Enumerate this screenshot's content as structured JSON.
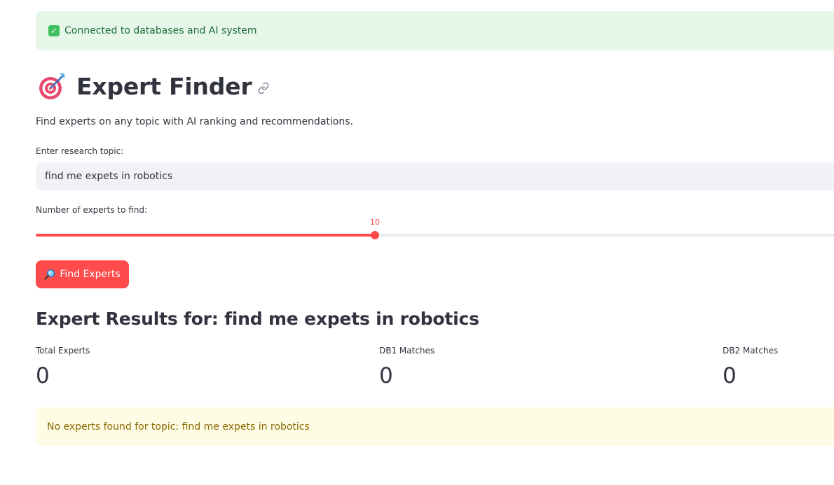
{
  "status": {
    "message": "Connected to databases and AI system",
    "icon": "check-box-icon",
    "color": "#e6f7ea"
  },
  "header": {
    "title": "Expert Finder",
    "title_icon": "target-icon",
    "anchor_icon": "link-icon"
  },
  "description": "Find experts on any topic with AI ranking and recommendations.",
  "topic_input": {
    "label": "Enter research topic:",
    "value": "find me expets in robotics"
  },
  "count_slider": {
    "label": "Number of experts to find:",
    "value": "10",
    "fill_fraction": 0.425,
    "accent": "#ff4b4b"
  },
  "search_button": {
    "label": "Find Experts",
    "icon": "magnifier-icon"
  },
  "results": {
    "heading": "Expert Results for: find me expets in robotics",
    "metrics": [
      {
        "label": "Total Experts",
        "value": "0"
      },
      {
        "label": "DB1 Matches",
        "value": "0"
      },
      {
        "label": "DB2 Matches",
        "value": "0"
      }
    ],
    "warning": "No experts found for topic: find me expets in robotics",
    "warning_color": "#fffce6"
  }
}
